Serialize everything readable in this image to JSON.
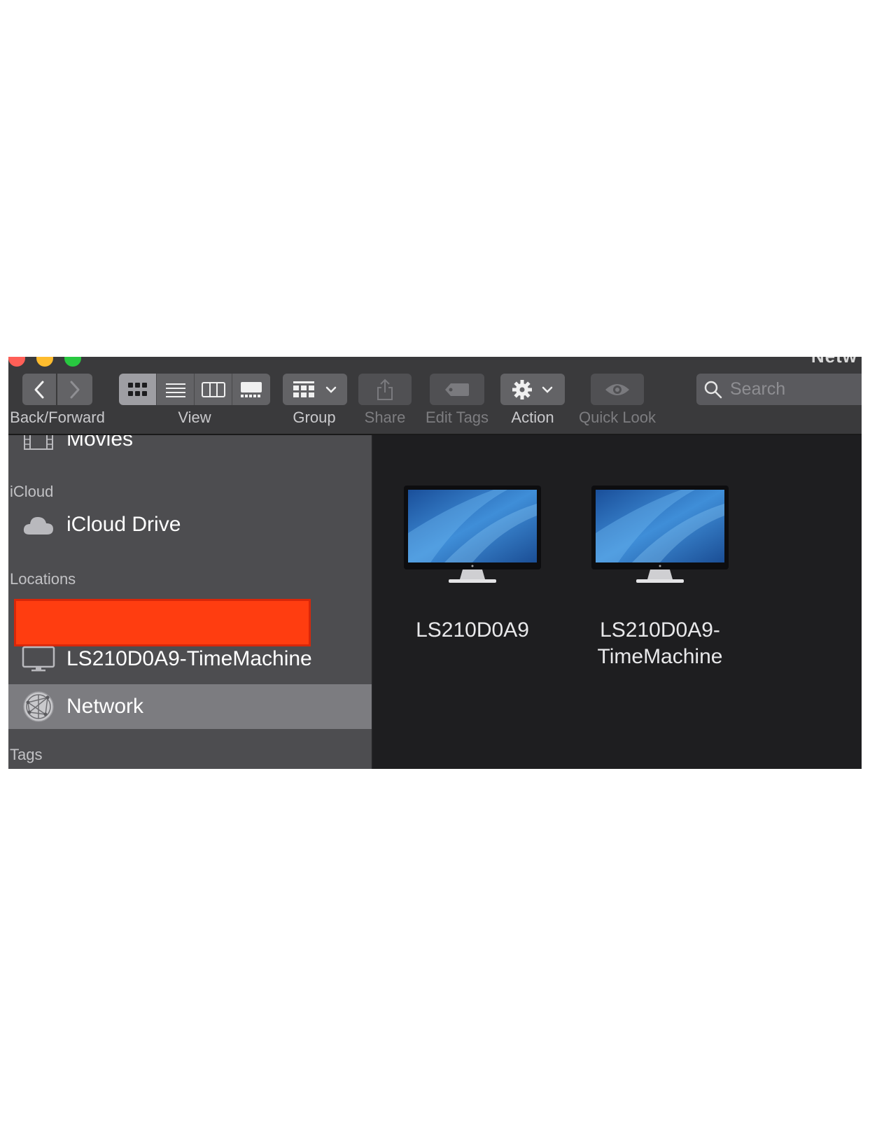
{
  "window": {
    "title_fragment": "Netw"
  },
  "toolbar": {
    "back_forward_label": "Back/Forward",
    "view_label": "View",
    "group_label": "Group",
    "share_label": "Share",
    "edit_tags_label": "Edit Tags",
    "action_label": "Action",
    "quick_look_label": "Quick Look",
    "search_placeholder": "Search",
    "view_modes": [
      "icon-view-icon",
      "list-view-icon",
      "column-view-icon",
      "gallery-view-icon"
    ],
    "active_view_mode": "icon"
  },
  "sidebar": {
    "items_top": [
      {
        "label": "Movies",
        "icon": "film-icon"
      }
    ],
    "icloud_header": "iCloud",
    "icloud_items": [
      {
        "label": "iCloud Drive",
        "icon": "cloud-icon"
      }
    ],
    "locations_header": "Locations",
    "locations_items": [
      {
        "label": "LS210D0A9-TimeMachine",
        "icon": "display-icon"
      },
      {
        "label": "Network",
        "icon": "network-globe-icon",
        "selected": true
      }
    ],
    "tags_header": "Tags"
  },
  "content": {
    "items": [
      {
        "label": "LS210D0A9",
        "icon": "monitor-icon"
      },
      {
        "label_line1": "LS210D0A9-",
        "label_line2": "TimeMachine",
        "icon": "monitor-icon"
      }
    ]
  },
  "colors": {
    "toolbar_bg": "#3a3a3c",
    "sidebar_bg": "#4d4d50",
    "content_bg": "#1e1e20",
    "selected_row": "#7c7c80",
    "redaction": "#ff3d10"
  }
}
